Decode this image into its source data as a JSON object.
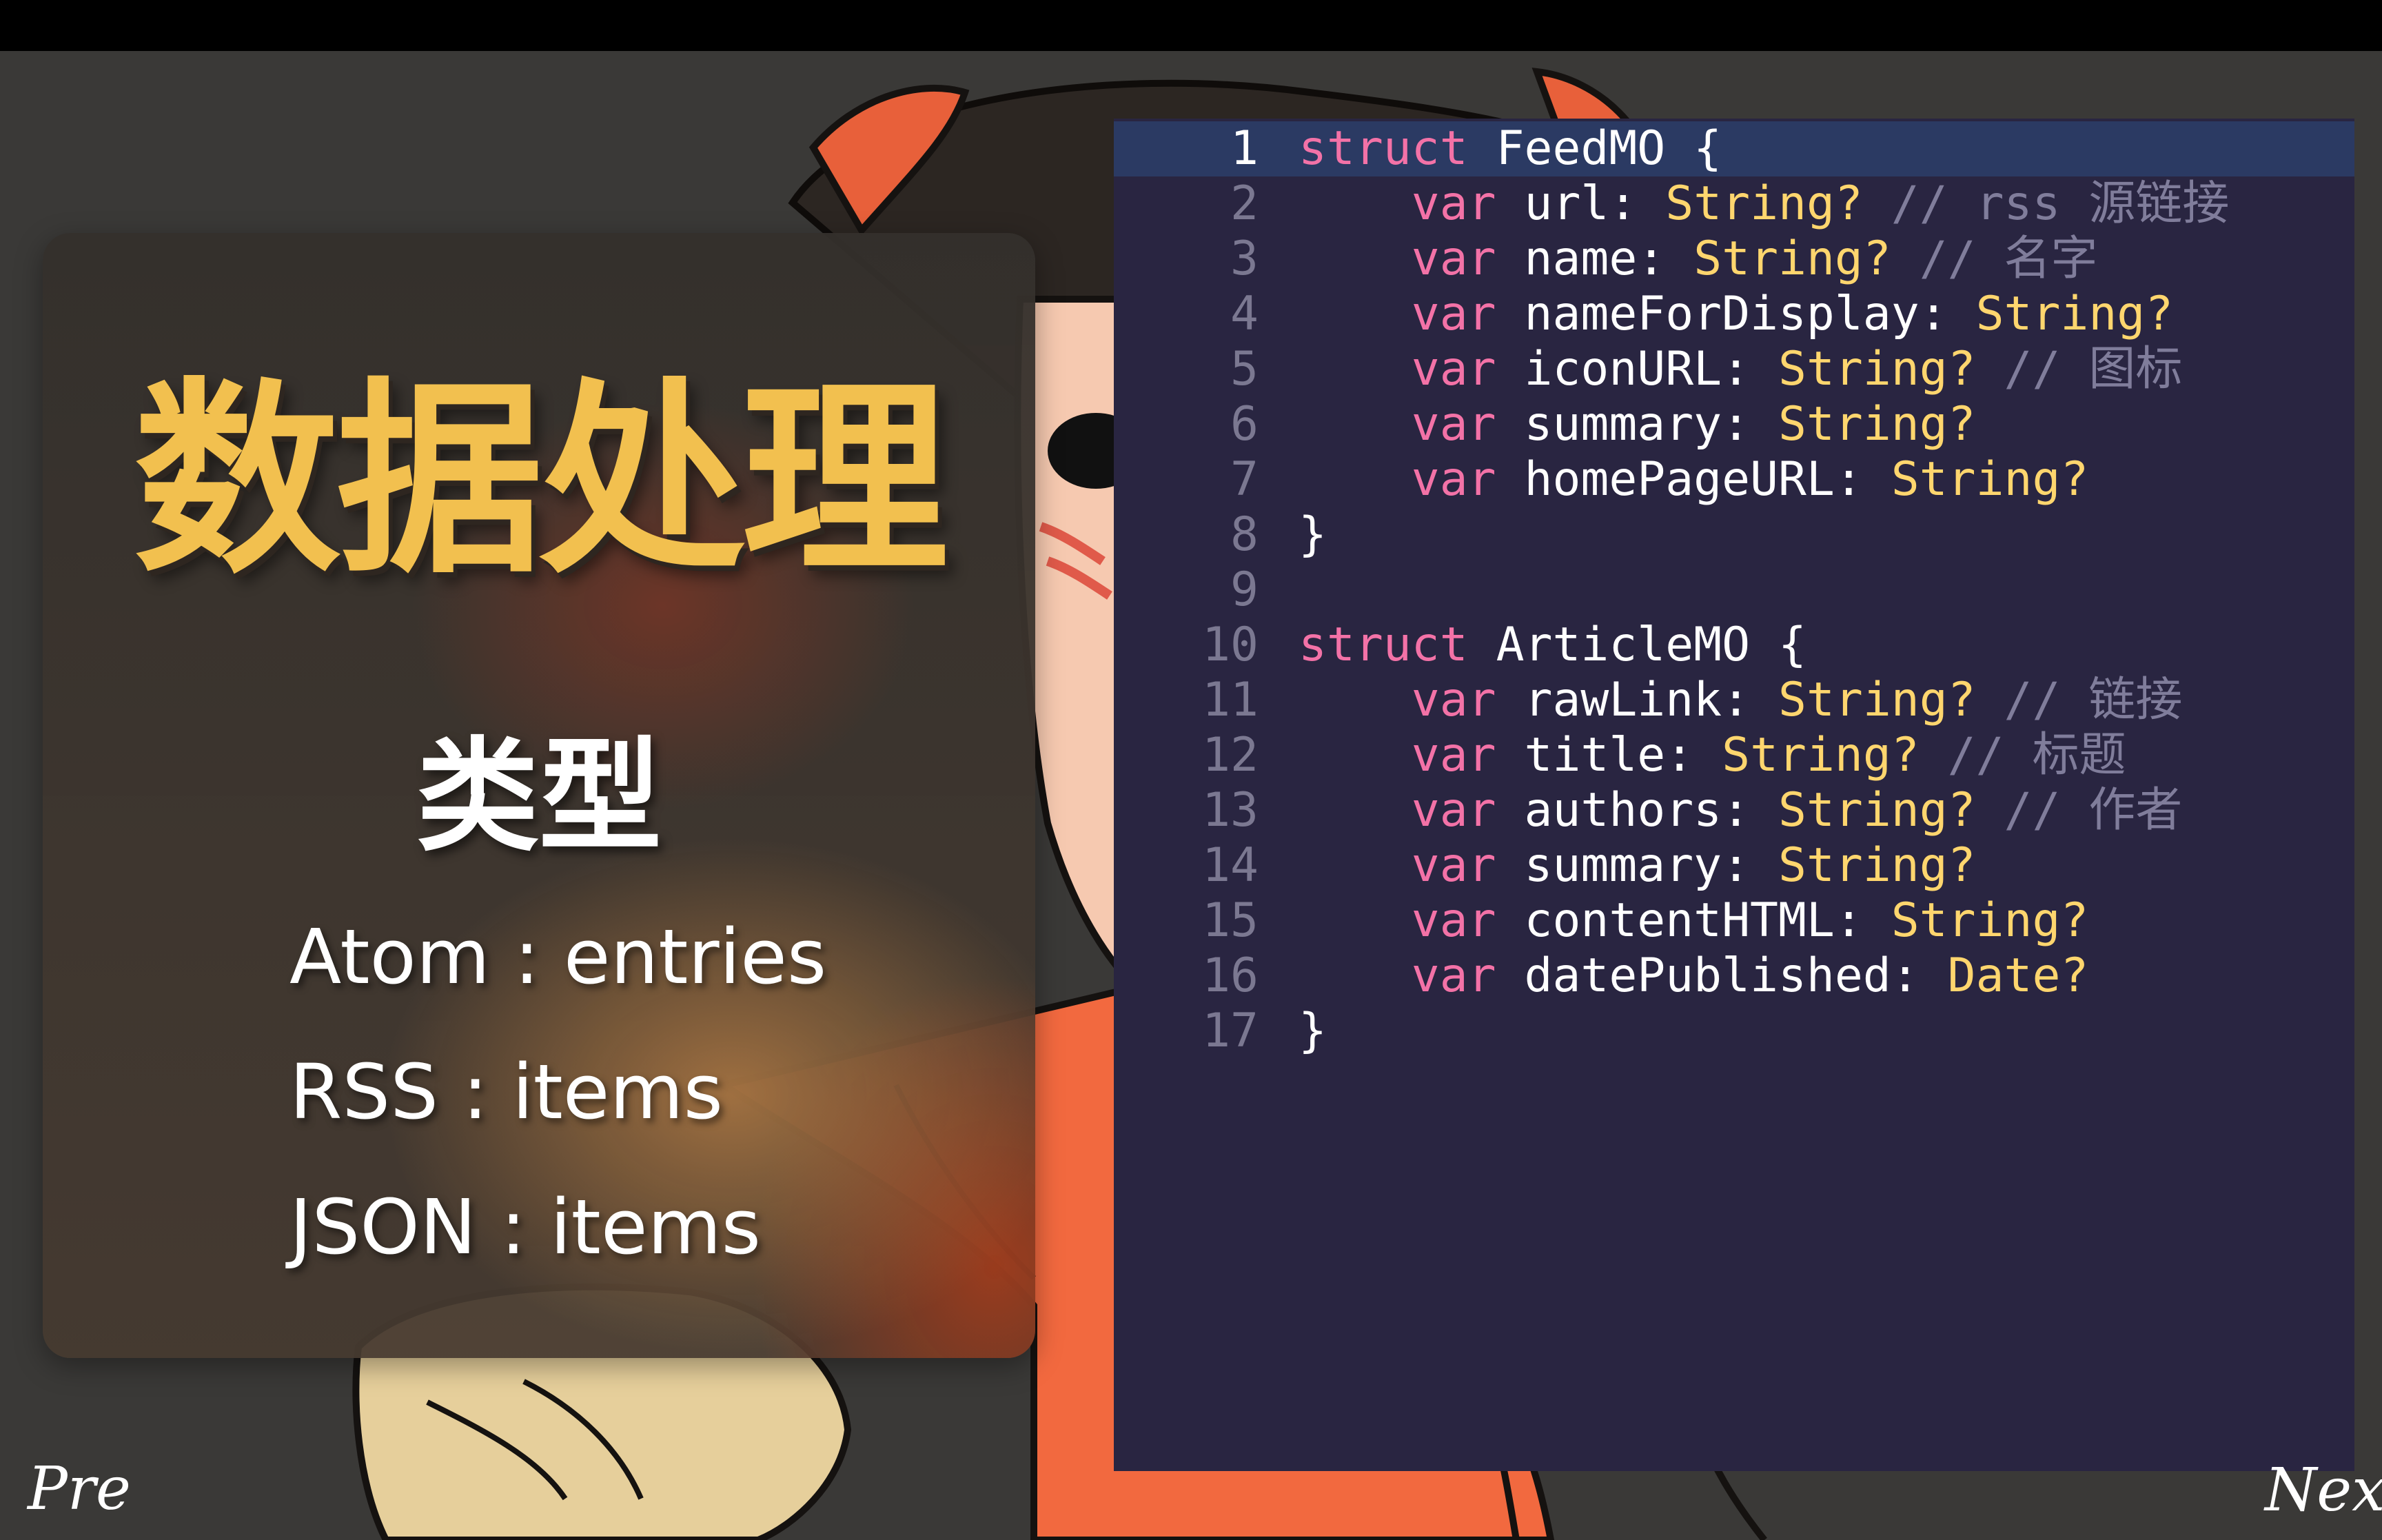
{
  "slide": {
    "title": "数据处理",
    "subtitle": "类型",
    "types": [
      {
        "label": "Atom : entries"
      },
      {
        "label": "RSS : items"
      },
      {
        "label": "JSON : items"
      }
    ]
  },
  "code": {
    "current_line": 1,
    "lines": [
      {
        "no": "1",
        "indent": "",
        "kw": "struct",
        "name": " FeedMO",
        "punct": " {",
        "type": "",
        "comment": ""
      },
      {
        "no": "2",
        "indent": "    ",
        "kw": "var",
        "name": " url",
        "punct": ": ",
        "type": "String?",
        "comment": " // rss 源链接"
      },
      {
        "no": "3",
        "indent": "    ",
        "kw": "var",
        "name": " name",
        "punct": ": ",
        "type": "String?",
        "comment": " // 名字"
      },
      {
        "no": "4",
        "indent": "    ",
        "kw": "var",
        "name": " nameForDisplay",
        "punct": ": ",
        "type": "String?",
        "comment": ""
      },
      {
        "no": "5",
        "indent": "    ",
        "kw": "var",
        "name": " iconURL",
        "punct": ": ",
        "type": "String?",
        "comment": " // 图标"
      },
      {
        "no": "6",
        "indent": "    ",
        "kw": "var",
        "name": " summary",
        "punct": ": ",
        "type": "String?",
        "comment": ""
      },
      {
        "no": "7",
        "indent": "    ",
        "kw": "var",
        "name": " homePageURL",
        "punct": ": ",
        "type": "String?",
        "comment": ""
      },
      {
        "no": "8",
        "indent": "",
        "kw": "",
        "name": "",
        "punct": "}",
        "type": "",
        "comment": ""
      },
      {
        "no": "9",
        "indent": "",
        "kw": "",
        "name": "",
        "punct": "",
        "type": "",
        "comment": ""
      },
      {
        "no": "10",
        "indent": "",
        "kw": "struct",
        "name": " ArticleMO",
        "punct": " {",
        "type": "",
        "comment": ""
      },
      {
        "no": "11",
        "indent": "    ",
        "kw": "var",
        "name": " rawLink",
        "punct": ": ",
        "type": "String?",
        "comment": " // 链接"
      },
      {
        "no": "12",
        "indent": "    ",
        "kw": "var",
        "name": " title",
        "punct": ": ",
        "type": "String?",
        "comment": " // 标题"
      },
      {
        "no": "13",
        "indent": "    ",
        "kw": "var",
        "name": " authors",
        "punct": ": ",
        "type": "String?",
        "comment": " // 作者"
      },
      {
        "no": "14",
        "indent": "    ",
        "kw": "var",
        "name": " summary",
        "punct": ": ",
        "type": "String?",
        "comment": ""
      },
      {
        "no": "15",
        "indent": "    ",
        "kw": "var",
        "name": " contentHTML",
        "punct": ": ",
        "type": "String?",
        "comment": ""
      },
      {
        "no": "16",
        "indent": "    ",
        "kw": "var",
        "name": " datePublished",
        "punct": ": ",
        "type": "Date?",
        "comment": ""
      },
      {
        "no": "17",
        "indent": "",
        "kw": "",
        "name": "",
        "punct": "}",
        "type": "",
        "comment": ""
      }
    ]
  },
  "nav": {
    "prev_label": "Pre",
    "next_label": "Next"
  },
  "colors": {
    "title": "#f2c04f",
    "code_bg": "#292541",
    "keyword": "#f372a7",
    "type": "#ffd66e",
    "comment": "#807d9b",
    "line_number": "#7b7891",
    "highlight": "#2b3a63"
  }
}
